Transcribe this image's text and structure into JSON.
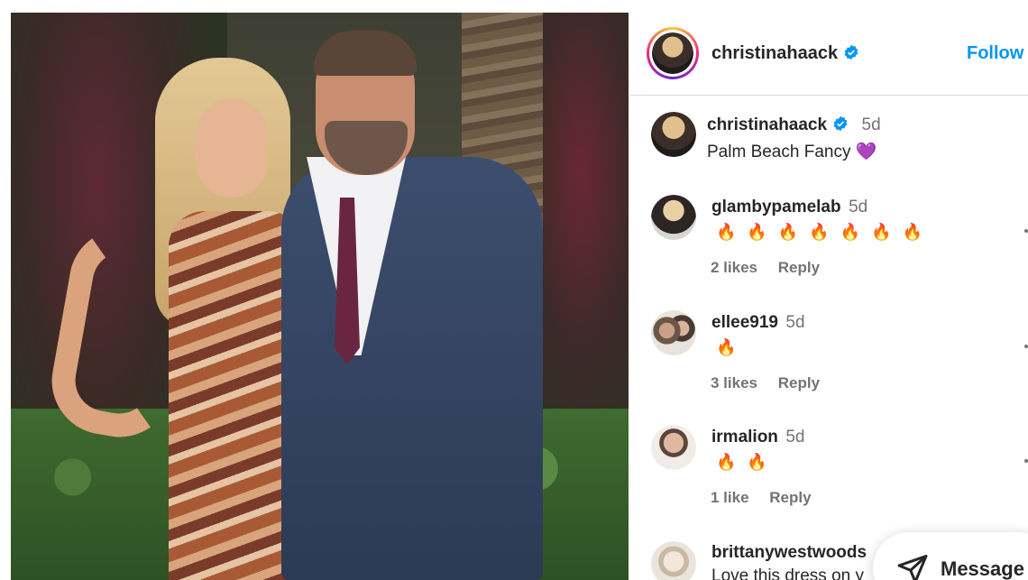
{
  "post": {
    "author": "christinahaack",
    "follow_label": "Follow",
    "caption": {
      "user": "christinahaack",
      "time": "5d",
      "text": "Palm Beach Fancy",
      "emoji": "💜"
    }
  },
  "comments": [
    {
      "user": "glambypamelab",
      "time": "5d",
      "fires": 7,
      "likes": "2 likes",
      "reply": "Reply"
    },
    {
      "user": "ellee919",
      "time": "5d",
      "fires": 1,
      "likes": "3 likes",
      "reply": "Reply"
    },
    {
      "user": "irmalion",
      "time": "5d",
      "fires": 2,
      "likes": "1 like",
      "reply": "Reply"
    },
    {
      "user": "brittanywestwoods",
      "text": "Love this dress on y"
    }
  ],
  "message_button": {
    "label": "Message",
    "icon": "send-icon"
  },
  "colors": {
    "accent": "#0095f6",
    "verified": "#0095f6",
    "muted": "#737373",
    "fire": "#ff6a00"
  }
}
